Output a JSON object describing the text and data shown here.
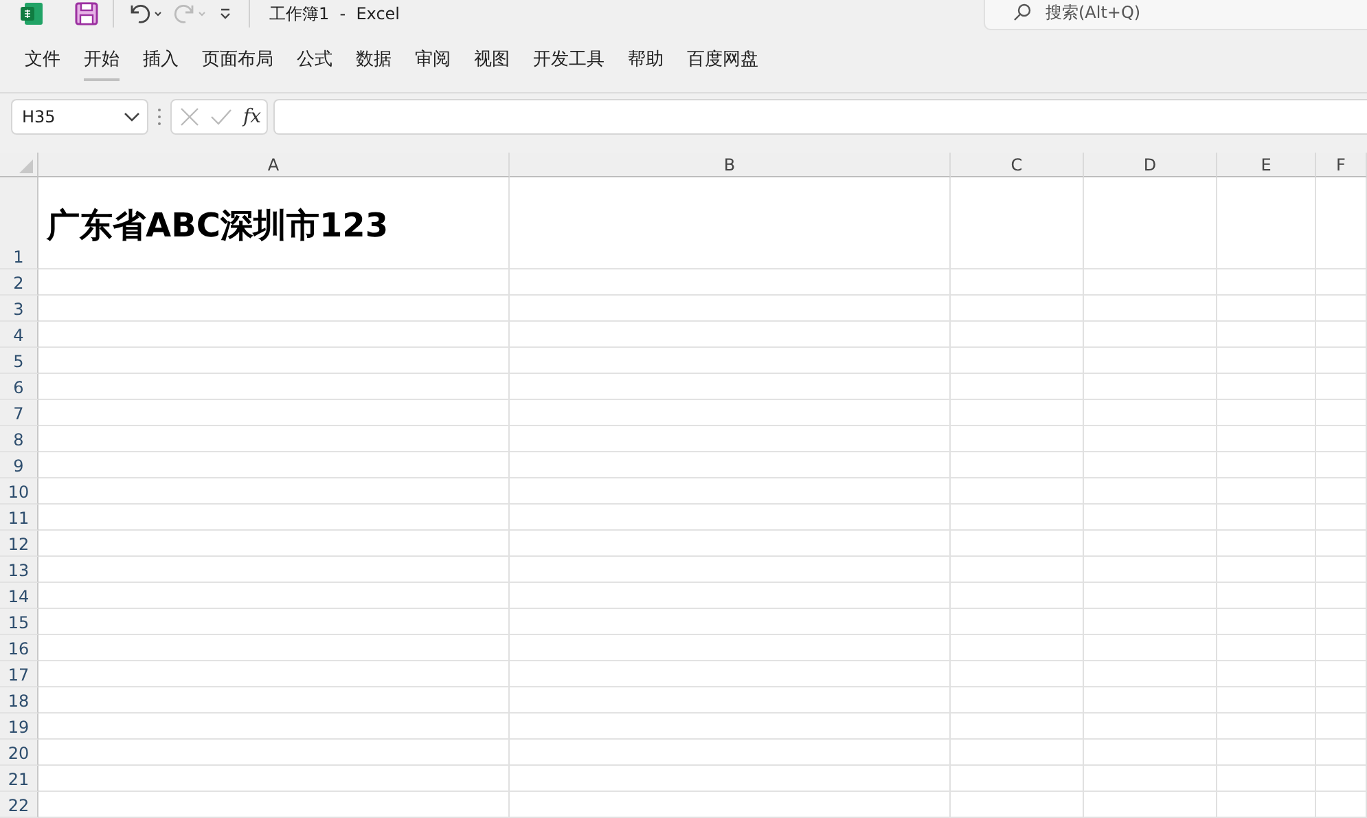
{
  "window": {
    "title": "工作簿1  -  Excel"
  },
  "search": {
    "placeholder": "搜索(Alt+Q)"
  },
  "ribbon_tabs": [
    {
      "label": "文件",
      "selected": false
    },
    {
      "label": "开始",
      "selected": true
    },
    {
      "label": "插入",
      "selected": false
    },
    {
      "label": "页面布局",
      "selected": false
    },
    {
      "label": "公式",
      "selected": false
    },
    {
      "label": "数据",
      "selected": false
    },
    {
      "label": "审阅",
      "selected": false
    },
    {
      "label": "视图",
      "selected": false
    },
    {
      "label": "开发工具",
      "selected": false
    },
    {
      "label": "帮助",
      "selected": false
    },
    {
      "label": "百度网盘",
      "selected": false
    }
  ],
  "formula_bar": {
    "name_box": "H35",
    "fx": "fx"
  },
  "columns": [
    "A",
    "B",
    "C",
    "D",
    "E",
    "F"
  ],
  "rows": [
    {
      "header": "1",
      "cells": [
        "广东省ABC深圳市123"
      ]
    },
    {
      "header": "2"
    },
    {
      "header": "3"
    },
    {
      "header": "4"
    },
    {
      "header": "5"
    },
    {
      "header": "6"
    },
    {
      "header": "7"
    },
    {
      "header": "8"
    },
    {
      "header": "9"
    },
    {
      "header": "10"
    },
    {
      "header": "11"
    },
    {
      "header": "12"
    },
    {
      "header": "13"
    },
    {
      "header": "14"
    },
    {
      "header": "15"
    },
    {
      "header": "16"
    },
    {
      "header": "17"
    },
    {
      "header": "18"
    },
    {
      "header": "19"
    },
    {
      "header": "20"
    },
    {
      "header": "21"
    },
    {
      "header": "22"
    }
  ]
}
